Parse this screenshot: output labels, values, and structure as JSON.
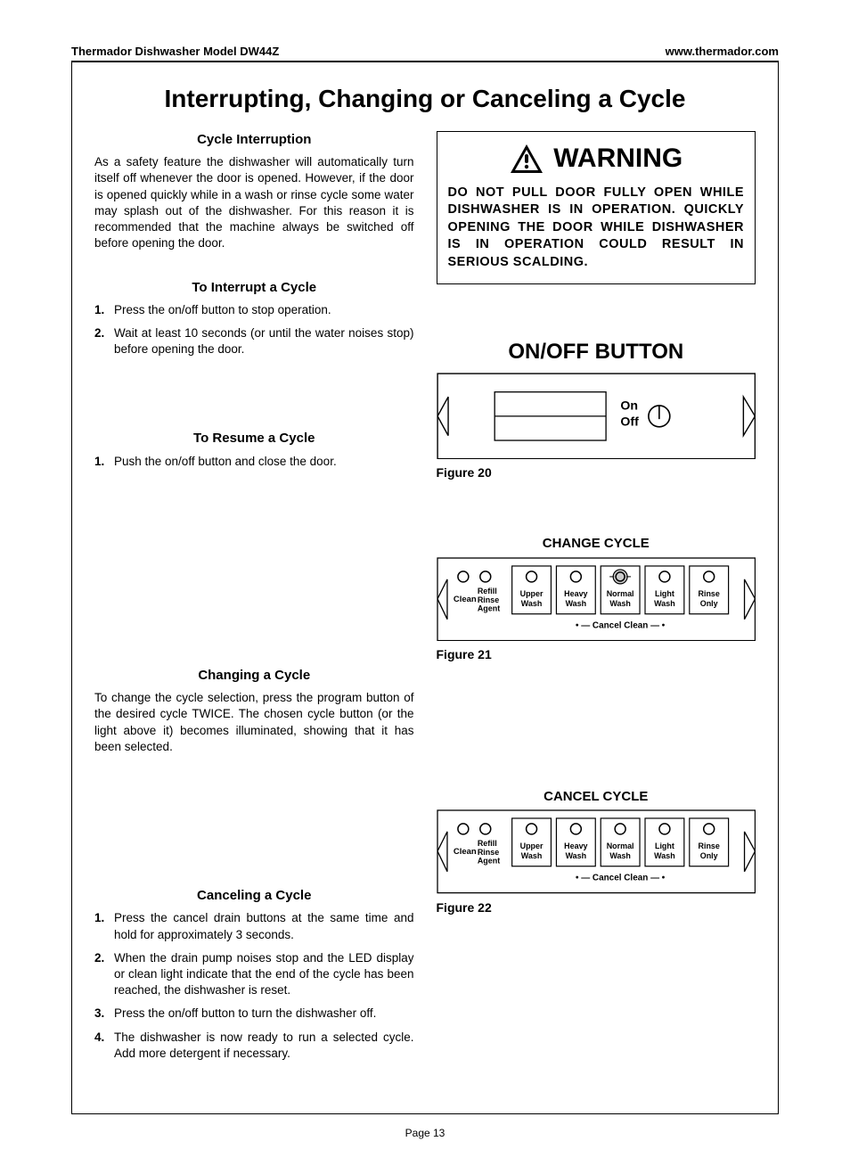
{
  "header": {
    "left": "Thermador Dishwasher Model DW44Z",
    "right": "www.thermador.com"
  },
  "title": "Interrupting, Changing or Canceling a Cycle",
  "cycle_interruption": {
    "heading": "Cycle Interruption",
    "body": "As a safety feature the dishwasher will automatically turn itself off whenever the door is opened. However, if the door is opened quickly while in a wash or rinse cycle some water may splash out of the dishwasher. For this reason it is recommended that the machine always be switched off before opening the door."
  },
  "to_interrupt": {
    "heading": "To Interrupt a Cycle",
    "items": [
      "Press the on/off button to stop operation.",
      "Wait at least 10 seconds (or until the water noises stop) before opening the door."
    ]
  },
  "to_resume": {
    "heading": "To Resume a Cycle",
    "items": [
      "Push the on/off button and close the door."
    ]
  },
  "changing": {
    "heading": "Changing a Cycle",
    "body": "To change the cycle selection, press the program button of the desired cycle TWICE.  The chosen cycle button (or the light above it) becomes illuminated, showing that it has been selected."
  },
  "canceling": {
    "heading": "Canceling a Cycle",
    "items": [
      "Press the cancel drain buttons at the same time and hold for approximately 3 seconds.",
      "When the drain pump noises stop and the LED display or clean light indicate that the end of the cycle has been reached, the dishwasher is reset.",
      "Press the on/off button to turn the dishwasher off.",
      "The dishwasher is now ready to run a selected cycle.  Add more detergent if necessary."
    ]
  },
  "warning": {
    "title": "WARNING",
    "body": "DO NOT PULL DOOR FULLY OPEN WHILE DISHWASHER IS IN OPERATION. QUICKLY OPENING THE DOOR WHILE DISHWASHER IS IN OPERATION COULD RESULT IN SERIOUS SCALDING."
  },
  "onoff": {
    "title": "ON/OFF BUTTON",
    "on": "On",
    "off": "Off",
    "fig": "Figure 20"
  },
  "change_panel": {
    "title": "CHANGE CYCLE",
    "fig": "Figure 21",
    "clean": "Clean",
    "refill": "Refill\nRinse\nAgent",
    "buttons": [
      "Upper\nWash",
      "Heavy\nWash",
      "Normal\nWash",
      "Light\nWash",
      "Rinse\nOnly"
    ],
    "cancel": "• — Cancel Clean — •"
  },
  "cancel_panel": {
    "title": "CANCEL CYCLE",
    "fig": "Figure 22",
    "clean": "Clean",
    "refill": "Refill\nRinse\nAgent",
    "buttons": [
      "Upper\nWash",
      "Heavy\nWash",
      "Normal\nWash",
      "Light\nWash",
      "Rinse\nOnly"
    ],
    "cancel": "• — Cancel Clean — •"
  },
  "page": "Page 13"
}
